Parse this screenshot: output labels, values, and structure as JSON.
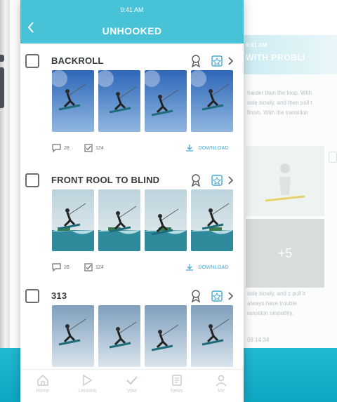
{
  "colors": {
    "accent": "#47c2d7",
    "link": "#47a8d4",
    "band": "#1cb3cd"
  },
  "app": {
    "time": "9:41 AM",
    "title": "UNHOOKED"
  },
  "lessons": [
    {
      "title": "BACKROLL",
      "comments": "28",
      "checks": "124",
      "download_label": "DOWNLOAD",
      "photos": 4,
      "photo_scene": "sky"
    },
    {
      "title": "FRONT ROOL TO BLIND",
      "comments": "28",
      "checks": "124",
      "download_label": "DOWNLOAD",
      "photos": 4,
      "photo_scene": "water"
    },
    {
      "title": "313",
      "comments": "",
      "checks": "",
      "download_label": "",
      "photos": 4,
      "photo_scene": "cloud"
    }
  ],
  "tabs": [
    {
      "label": "Home",
      "icon": "home-icon"
    },
    {
      "label": "Lessons",
      "icon": "play-icon"
    },
    {
      "label": "Vote",
      "icon": "check-icon"
    },
    {
      "label": "News",
      "icon": "news-icon"
    },
    {
      "label": "Me",
      "icon": "user-icon"
    }
  ],
  "second_screen": {
    "time": "9:41 AM",
    "title": "WITH PROBLI",
    "text_top": "harder than the loop. With\nside slowly, and then pull t\nfinish. With the transition",
    "overflow_count": "+5",
    "text_bottom": "side slowly, and z pull it\nalways have trouble\nransition smoothly.",
    "timestamp": "08 14:34"
  }
}
